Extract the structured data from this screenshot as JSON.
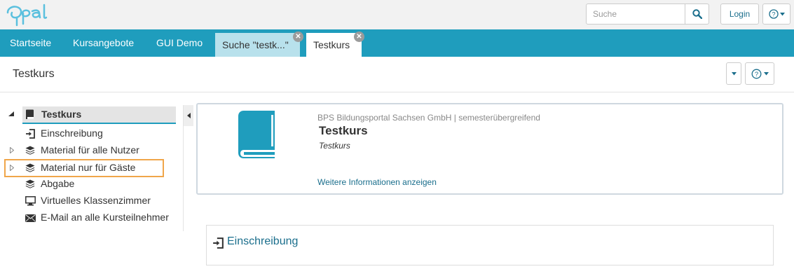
{
  "header": {
    "logo_text": "Opal",
    "search": {
      "placeholder": "Suche"
    },
    "login_label": "Login"
  },
  "nav": {
    "items": [
      {
        "label": "Startseite"
      },
      {
        "label": "Kursangebote"
      },
      {
        "label": "GUI Demo"
      }
    ],
    "tabs": [
      {
        "label": "Suche \"testk...\"",
        "closable": true,
        "active": false
      },
      {
        "label": "Testkurs",
        "closable": true,
        "active": true
      }
    ]
  },
  "page": {
    "title": "Testkurs"
  },
  "sidebar": {
    "root": {
      "label": "Testkurs",
      "icon": "book-icon",
      "expanded": true
    },
    "items": [
      {
        "label": "Einschreibung",
        "icon": "enrollment-icon",
        "has_children": false
      },
      {
        "label": "Material für alle Nutzer",
        "icon": "layers-icon",
        "has_children": true
      },
      {
        "label": "Material nur für Gäste",
        "icon": "layers-icon",
        "has_children": true,
        "highlighted": true
      },
      {
        "label": "Abgabe",
        "icon": "layers-icon",
        "has_children": false
      },
      {
        "label": "Virtuelles Klassenzimmer",
        "icon": "monitor-icon",
        "has_children": false
      },
      {
        "label": "E-Mail an alle Kursteilnehmer",
        "icon": "envelope-icon",
        "has_children": false
      }
    ]
  },
  "course": {
    "provider": "BPS Bildungsportal Sachsen GmbH | semesterübergreifend",
    "title": "Testkurs",
    "subtitle": "Testkurs",
    "more_info_label": "Weitere Informationen anzeigen"
  },
  "enrollment": {
    "label": "Einschreibung"
  },
  "colors": {
    "brand": "#1f9dbd",
    "link": "#1a6e8c",
    "highlight_border": "#f0a64a",
    "search_tab_bg": "#b8e1ec"
  }
}
